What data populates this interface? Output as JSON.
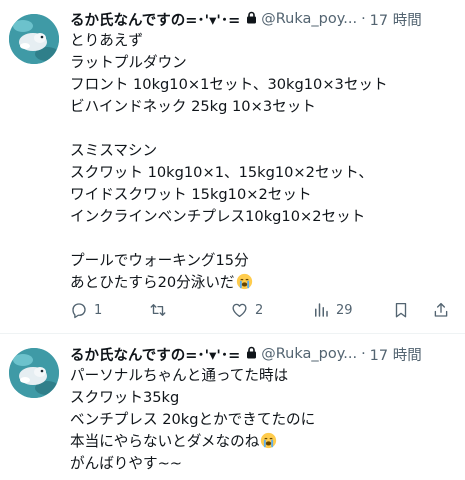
{
  "tweets": [
    {
      "author": {
        "display_name": "るか氏なんですの",
        "name_suffix": "=･'▾'･=",
        "handle": "@Ruka_poy...",
        "avatar_icon": "avatar-image"
      },
      "separator": "·",
      "time": "17 時間",
      "more_icon": "more-icon",
      "lines": [
        "とりあえず",
        "ラットプルダウン",
        "フロント 10kg10×1セット、30kg10×3セット",
        "ビハインドネック 25kg 10×3セット",
        "",
        "スミスマシン",
        "スクワット 10kg10×1、15kg10×2セット、",
        "ワイドスクワット 15kg10×2セット",
        "インクラインベンチプレス10kg10×2セット",
        "",
        "プールでウォーキング15分",
        "あとひたすら20分泳いだ"
      ],
      "emoji_last_line": "loudly-crying-face",
      "actions": {
        "replies": "1",
        "retweets": "",
        "likes": "2",
        "views": "29"
      }
    },
    {
      "author": {
        "display_name": "るか氏なんですの",
        "name_suffix": "=･'▾'･=",
        "handle": "@Ruka_poy...",
        "avatar_icon": "avatar-image"
      },
      "separator": "·",
      "time": "17 時間",
      "more_icon": "more-icon",
      "lines": [
        "パーソナルちゃんと通ってた時は",
        "スクワット35kg",
        "ベンチプレス 20kgとかできてたのに",
        "本当にやらないとダメなのね",
        "がんばりやす~~"
      ],
      "emoji_line_index": 3,
      "emoji": "loudly-crying-face"
    }
  ],
  "colors": {
    "text": "#0f1419",
    "secondary": "#536471",
    "divider": "#eff3f4",
    "avatar_bg": "#3f9aa6"
  }
}
